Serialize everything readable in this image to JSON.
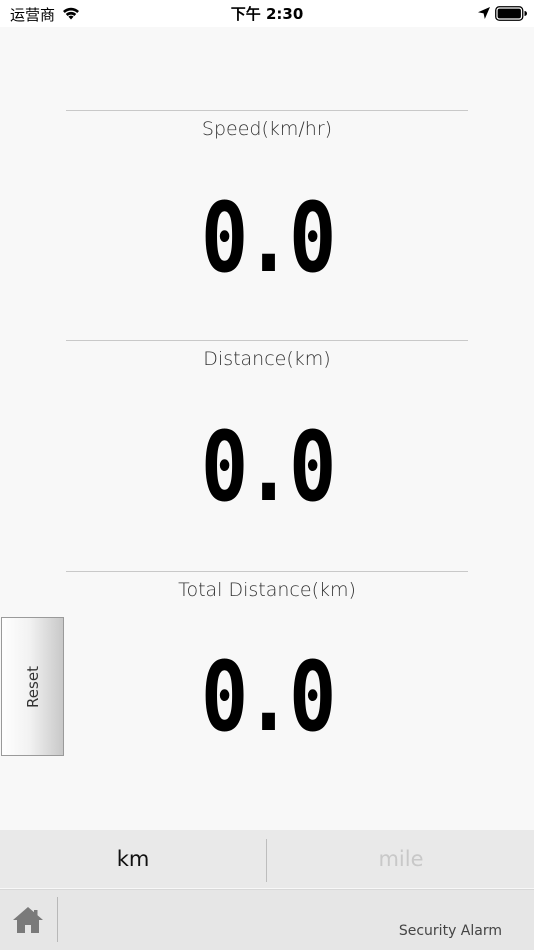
{
  "status_bar": {
    "carrier": "运营商",
    "time": "下午 2:30",
    "wifi_icon": "wifi-icon",
    "location_icon": "location-arrow-icon",
    "battery_icon": "battery-full-icon"
  },
  "metrics": {
    "speed": {
      "label": "Speed(km/hr)",
      "value": "0.0"
    },
    "distance": {
      "label": "Distance(km)",
      "value": "0.0"
    },
    "total_distance": {
      "label": "Total Distance(km)",
      "value": "0.0"
    }
  },
  "reset": {
    "label": "Reset"
  },
  "units": {
    "km": "km",
    "mile": "mile",
    "selected": "km",
    "active_color": "#111111",
    "inactive_color": "#c8c8c8"
  },
  "bottom_bar": {
    "home_icon": "home-icon",
    "security_alarm_label": "Security Alarm"
  }
}
